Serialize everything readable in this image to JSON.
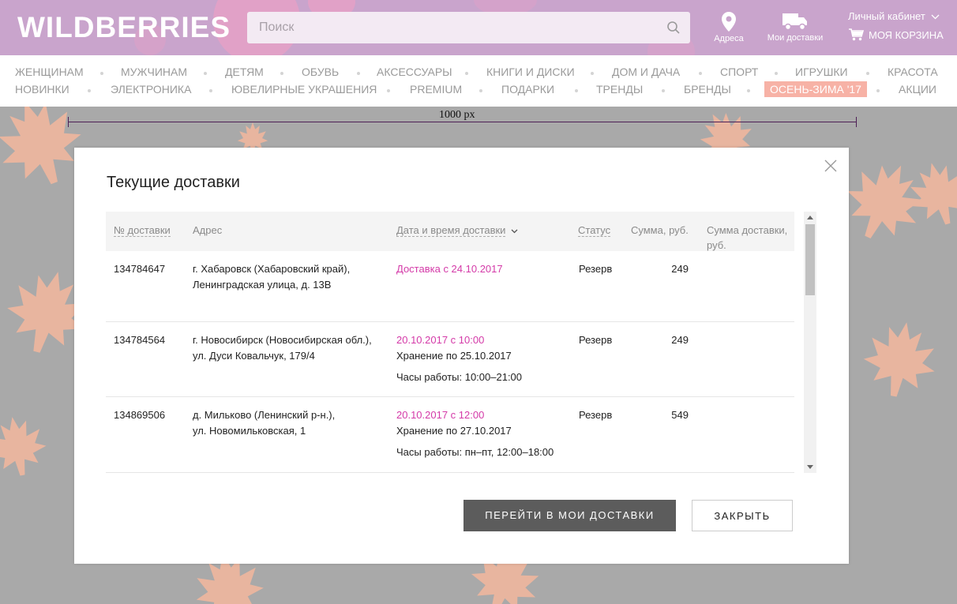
{
  "header": {
    "logo": "WILDBERRIES",
    "search_placeholder": "Поиск",
    "address_label": "Адреса",
    "deliveries_label": "Мои доставки",
    "cabinet_label": "Личный кабинет",
    "cart_label": "МОЯ КОРЗИНА",
    "bg_color": "#c9a4cc"
  },
  "nav": {
    "row1": [
      "Женщинам",
      "Мужчинам",
      "Детям",
      "Обувь",
      "Аксессуары",
      "Книги и диски",
      "Дом и дача",
      "Спорт",
      "Игрушки",
      "Красота"
    ],
    "row2": [
      "Новинки",
      "Электроника",
      "Ювелирные украшения",
      "Premium",
      "Подарки",
      "Тренды",
      "Бренды",
      "Осень-Зима '17",
      "Акции"
    ]
  },
  "ruler": {
    "label": "1000 px"
  },
  "modal": {
    "title": "Текущие доставки",
    "columns": {
      "number": "№ доставки",
      "address": "Адрес",
      "datetime": "Дата и время доставки",
      "status": "Статус",
      "sum": "Сумма, руб.",
      "delivery_sum_1": "Сумма доставки,",
      "delivery_sum_2": "руб."
    },
    "rows": [
      {
        "number": "134784647",
        "address_1": "г. Хабаровск (Хабаровский край),",
        "address_2": "Ленинградская улица, д. 13В",
        "date": "Доставка с 24.10.2017",
        "storage": "",
        "hours": "",
        "status": "Резерв",
        "sum": "249"
      },
      {
        "number": "134784564",
        "address_1": "г. Новосибирск (Новосибирская обл.),",
        "address_2": "ул. Дуси Ковальчук, 179/4",
        "date": "20.10.2017 с 10:00",
        "storage": "Хранение по 25.10.2017",
        "hours": "Часы работы: 10:00–21:00",
        "status": "Резерв",
        "sum": "249"
      },
      {
        "number": "134869506",
        "address_1": "д. Мильково (Ленинский р-н.),",
        "address_2": "ул. Новомильковская, 1",
        "date": "20.10.2017 с 12:00",
        "storage": "Хранение по 27.10.2017",
        "hours": "Часы работы: пн–пт, 12:00–18:00",
        "status": "Резерв",
        "sum": "549"
      }
    ],
    "primary_button": "ПЕРЕЙТИ В МОИ ДОСТАВКИ",
    "secondary_button": "ЗАКРЫТЬ"
  },
  "colors": {
    "accent_pink": "#d43aa8",
    "highlight_nav": "#f7b2a6",
    "leaf": "#f4b79d"
  }
}
